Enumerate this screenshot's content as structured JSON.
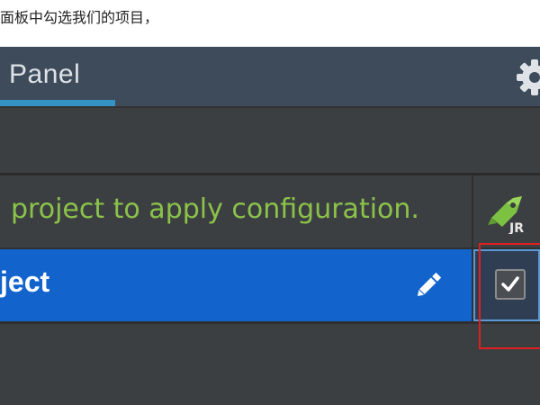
{
  "caption": "面板中勾选我们的项目，",
  "panel": {
    "tab_label": "Panel",
    "settings_icon": "gear-icon"
  },
  "table": {
    "hint": "project to apply configuration.",
    "header_icon": "jrebel-icon",
    "header_icon_text": "JR",
    "rows": [
      {
        "name": "ject",
        "edit_icon": "pencil-icon",
        "checked": true
      }
    ]
  },
  "colors": {
    "hint_green": "#8bc34a",
    "selection_blue": "#1264cc",
    "tab_accent": "#3592c4",
    "highlight_red": "#e02020"
  }
}
